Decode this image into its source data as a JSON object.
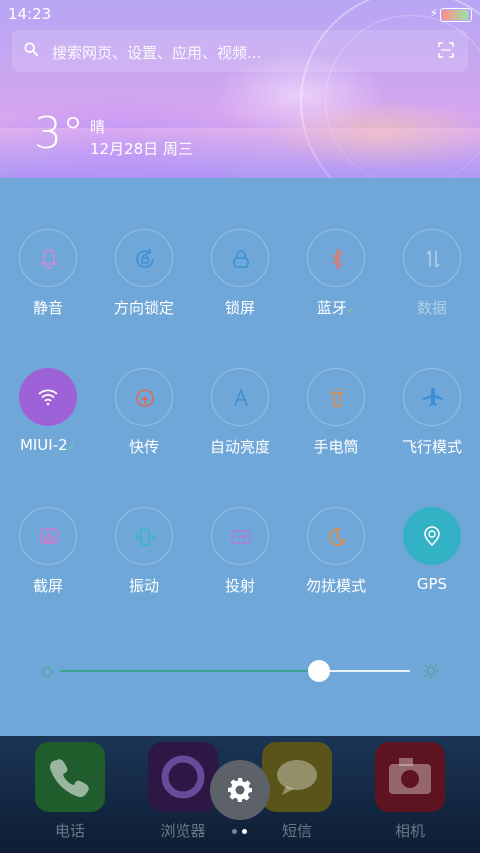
{
  "status": {
    "time": "14:23"
  },
  "search": {
    "placeholder": "搜索网页、设置、应用、视频..."
  },
  "weather": {
    "temperature": "3°",
    "condition": "晴",
    "date": "12月28日 周三"
  },
  "toggles": [
    {
      "label": "静音",
      "icon": "bell-icon",
      "state": "off"
    },
    {
      "label": "方向锁定",
      "icon": "rotation-lock-icon",
      "state": "off"
    },
    {
      "label": "锁屏",
      "icon": "lock-icon",
      "state": "off"
    },
    {
      "label": "蓝牙",
      "icon": "bluetooth-icon",
      "state": "off",
      "checked": true
    },
    {
      "label": "数据",
      "icon": "mobile-data-icon",
      "state": "disabled"
    },
    {
      "label": "MIUI-2",
      "icon": "wifi-icon",
      "state": "on",
      "checked": true
    },
    {
      "label": "快传",
      "icon": "quick-transfer-icon",
      "state": "off"
    },
    {
      "label": "自动亮度",
      "icon": "auto-brightness-icon",
      "state": "off"
    },
    {
      "label": "手电筒",
      "icon": "flashlight-icon",
      "state": "off"
    },
    {
      "label": "飞行模式",
      "icon": "airplane-icon",
      "state": "off"
    },
    {
      "label": "截屏",
      "icon": "screenshot-icon",
      "state": "off"
    },
    {
      "label": "振动",
      "icon": "vibrate-icon",
      "state": "off"
    },
    {
      "label": "投射",
      "icon": "cast-icon",
      "state": "off"
    },
    {
      "label": "勿扰模式",
      "icon": "moon-icon",
      "state": "off"
    },
    {
      "label": "GPS",
      "icon": "gps-icon",
      "state": "on"
    }
  ],
  "brightness": {
    "level": 0.74
  },
  "dock": [
    {
      "name": "电话",
      "icon": "phone-icon",
      "color": "#2a8a3a"
    },
    {
      "name": "浏览器",
      "icon": "browser-icon",
      "color": "#3a1d5a"
    },
    {
      "name": "短信",
      "icon": "message-icon",
      "color": "#8a7a1a"
    },
    {
      "name": "相机",
      "icon": "camera-icon",
      "color": "#8a1e2a"
    }
  ],
  "colors": {
    "panel": "#6fa8d8",
    "accent_purple": "#9e61d8",
    "accent_teal": "#33b2c6"
  }
}
